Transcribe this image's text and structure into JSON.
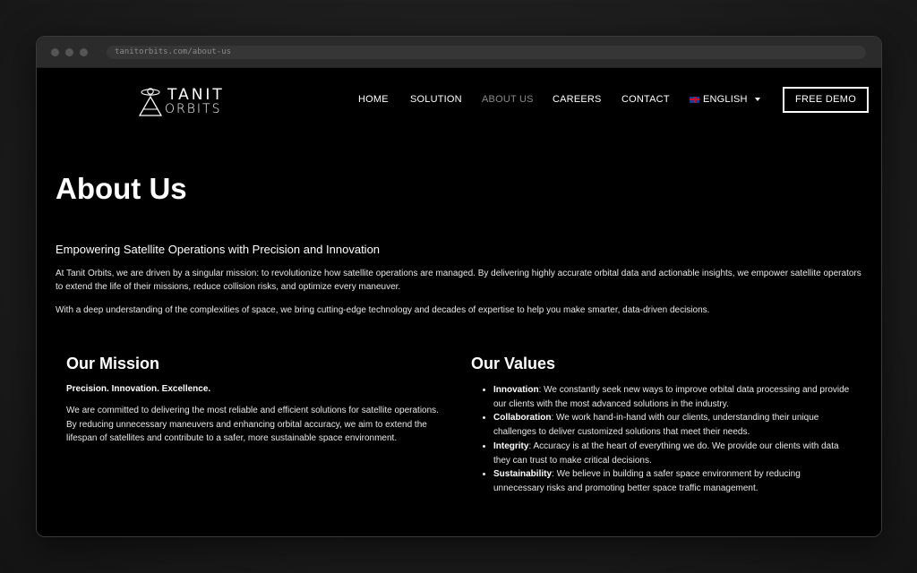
{
  "browser": {
    "url": "tanitorbits.com/about-us"
  },
  "logo": {
    "line1": "TANIT",
    "line2": "ORBITS"
  },
  "nav": {
    "items": [
      {
        "label": "HOME",
        "active": false
      },
      {
        "label": "SOLUTION",
        "active": false
      },
      {
        "label": "ABOUT US",
        "active": true
      },
      {
        "label": "CAREERS",
        "active": false
      },
      {
        "label": "CONTACT",
        "active": false
      }
    ],
    "language": "ENGLISH",
    "language_flag": "uk-flag-icon",
    "demo_button": "FREE DEMO"
  },
  "hero": {
    "title": "About Us",
    "subtitle": "Empowering Satellite Operations with Precision and Innovation",
    "paragraph1": "At Tanit Orbits, we are driven by a singular mission: to revolutionize how satellite operations are managed. By delivering highly accurate orbital data and actionable insights, we empower satellite operators to extend the life of their missions, reduce collision risks, and optimize every maneuver.",
    "paragraph2": "With a deep understanding of the complexities of space, we bring cutting-edge technology and decades of expertise to help you make smarter, data-driven decisions."
  },
  "mission": {
    "title": "Our Mission",
    "tagline": "Precision. Innovation. Excellence.",
    "body": "We are committed to delivering the most reliable and efficient solutions for satellite operations. By reducing unnecessary maneuvers and enhancing orbital accuracy, we aim to extend the lifespan of satellites and contribute to a safer, more sustainable space environment."
  },
  "values": {
    "title": "Our Values",
    "items": [
      {
        "name": "Innovation",
        "text": ": We constantly seek new ways to improve orbital data processing and provide our clients with the most advanced solutions in the industry."
      },
      {
        "name": "Collaboration",
        "text": ": We work hand-in-hand with our clients, understanding their unique challenges to deliver customized solutions that meet their needs."
      },
      {
        "name": "Integrity",
        "text": ": Accuracy is at the heart of everything we do. We provide our clients with data they can trust to make critical decisions."
      },
      {
        "name": "Sustainability",
        "text": ": We believe in building a safer space environment by reducing unnecessary risks and promoting better space traffic management."
      }
    ]
  },
  "colors": {
    "background": "#000000",
    "text": "#ffffff",
    "active_nav": "#8a8a8a",
    "window_chrome": "#2b2b2b"
  }
}
